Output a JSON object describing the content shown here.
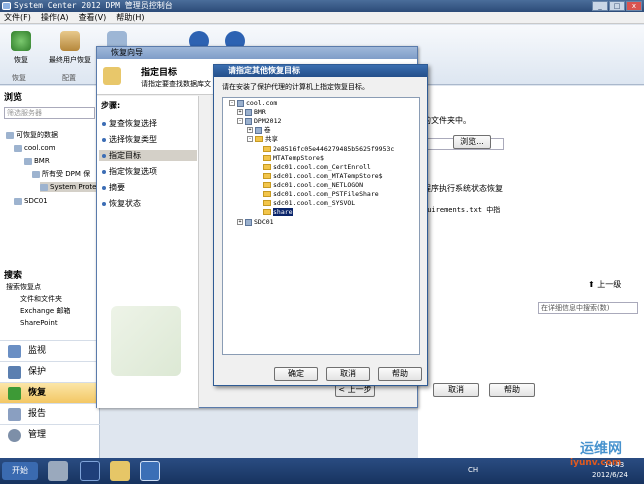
{
  "window": {
    "title": "System Center 2012 DPM 管理员控制台"
  },
  "menu": [
    "文件(F)",
    "操作(A)",
    "查看(V)",
    "帮助(H)"
  ],
  "ribbon": {
    "buttons": [
      "恢复",
      "最终用户恢复"
    ],
    "groups": [
      "恢复",
      "配置"
    ]
  },
  "nav": {
    "title": "浏览",
    "search_placeholder": "筛选服务器",
    "tree": [
      "可恢复的数据",
      "cool.com",
      "BMR",
      "所有受 DPM 保",
      "System Prote",
      "SDC01"
    ],
    "search_title": "搜索",
    "search_items": [
      "搜索恢复点",
      "文件和文件夹",
      "Exchange 邮箱",
      "SharePoint"
    ],
    "workspaces": [
      "监视",
      "保护",
      "恢复",
      "报告",
      "管理"
    ]
  },
  "wizard": {
    "title": "恢复向导",
    "heading": "指定目标",
    "subtitle": "请指定要查找数据库文",
    "steps_label": "步骤:",
    "steps": [
      "复查恢复选择",
      "选择恢复类型",
      "指定目标",
      "指定恢复选项",
      "摘要",
      "恢复状态"
    ],
    "fragments": [
      "的文件夹中。",
      "浏览...",
      "程序执行系统状态恢复",
      "quirements.txt 中指"
    ],
    "buttons": {
      "back": "< 上一步",
      "cancel": "取消",
      "help": "帮助"
    }
  },
  "dialog": {
    "title": "请指定其他恢复目标",
    "instruction": "请在安装了保护代理的计算机上指定恢复目标。",
    "tree": [
      "cool.com",
      "BMR",
      "DPM2012",
      "卷",
      "共享",
      "2e8516fc05e446279485b5625f9953c",
      "MTATempStore$",
      "sdc01.cool.com_CertEnroll",
      "sdc01.cool.com_MTATempStore$",
      "sdc01.cool.com_NETLOGON",
      "sdc01.cool.com_PSTFileShare",
      "sdc01.cool.com_SYSVOL",
      "share",
      "SDC01"
    ],
    "buttons": {
      "ok": "确定",
      "cancel": "取消",
      "help": "帮助"
    }
  },
  "right": {
    "up_label": "上一级",
    "search_hint": "在详细信息中搜索(数)"
  },
  "taskbar": {
    "start": "开始",
    "time": "14:43",
    "date": "2012/6/24",
    "lang": "CH"
  },
  "watermark": {
    "text": "运维网",
    "url": "iyunv.com"
  }
}
